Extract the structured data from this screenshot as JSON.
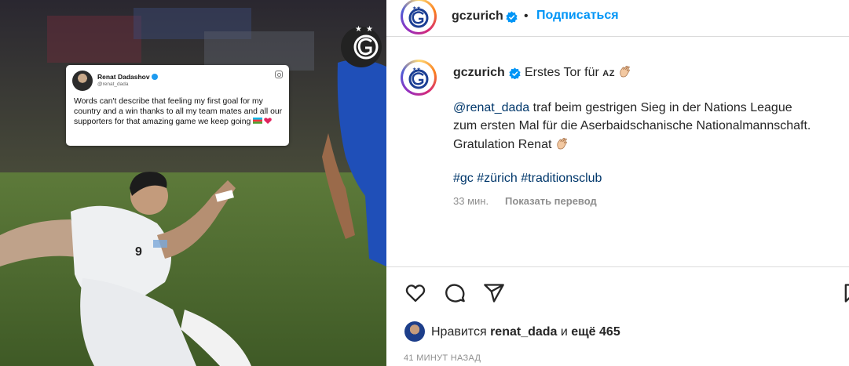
{
  "header": {
    "username": "gczurich",
    "separator": "•",
    "follow_label": "Подписаться"
  },
  "tweet": {
    "name": "Renat Dadashov",
    "handle": "@renat_dada",
    "text": "Words can't describe that feeling my first goal for my country and a win thanks to all my team mates and all our supporters for that amazing game we keep going"
  },
  "jersey_number": "9",
  "caption": {
    "username": "gczurich",
    "first_line": "Erstes Tor für",
    "flag_code": "AZ",
    "mention": "@renat_dada",
    "line1_rest": " traf beim gestrigen Sieg in der Nations League",
    "line2": "zum ersten Mal für die Aserbaidschanische Nationalmannschaft.",
    "line3": "Gratulation Renat",
    "hashtags": [
      "#gc",
      "#zürich",
      "#traditionsclub"
    ],
    "time": "33 мин.",
    "translate_label": "Показать перевод"
  },
  "likes": {
    "prefix": "Нравится",
    "user": "renat_dada",
    "conj": "и",
    "others": "ещё 465"
  },
  "posted": "41 МИНУТ НАЗАД",
  "colors": {
    "accent": "#0095f6",
    "verified": "#0095f6",
    "link": "#00376b",
    "muted": "#8e8e8e"
  },
  "icons": [
    "heart-icon",
    "comment-icon",
    "share-icon",
    "bookmark-icon",
    "verified-icon",
    "clap-icon"
  ]
}
